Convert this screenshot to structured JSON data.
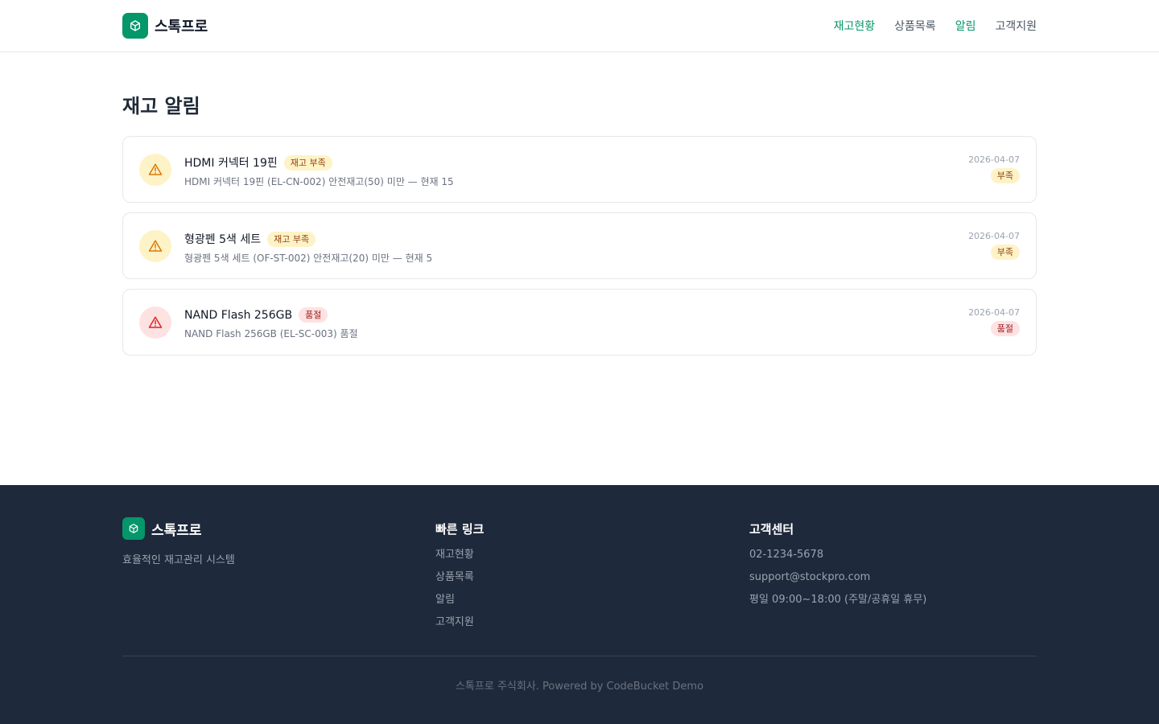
{
  "brand": {
    "name": "스톡프로",
    "logo_icon": "box-icon",
    "color": "#059669"
  },
  "nav": [
    {
      "label": "재고현황",
      "active": true
    },
    {
      "label": "상품목록",
      "active": false
    },
    {
      "label": "알림",
      "active": true
    },
    {
      "label": "고객지원",
      "active": false
    }
  ],
  "page": {
    "title": "재고 알림"
  },
  "alerts": [
    {
      "title": "HDMI 커넥터 19핀",
      "badge": "재고 부족",
      "description": "HDMI 커넥터 19핀 (EL-CN-002) 안전재고(50) 미만 — 현재 15",
      "date": "2026-04-07",
      "status": "부족",
      "level": "warn",
      "icon": "warning-triangle-icon"
    },
    {
      "title": "형광펜 5색 세트",
      "badge": "재고 부족",
      "description": "형광펜 5색 세트 (OF-ST-002) 안전재고(20) 미만 — 현재 5",
      "date": "2026-04-07",
      "status": "부족",
      "level": "warn",
      "icon": "warning-triangle-icon"
    },
    {
      "title": "NAND Flash 256GB",
      "badge": "품절",
      "description": "NAND Flash 256GB (EL-SC-003) 품절",
      "date": "2026-04-07",
      "status": "품절",
      "level": "danger",
      "icon": "warning-triangle-icon"
    }
  ],
  "footer": {
    "brand_name": "스톡프로",
    "tagline": "효율적인 재고관리 시스템",
    "quick_links": {
      "heading": "빠른 링크",
      "items": [
        "재고현황",
        "상품목록",
        "알림",
        "고객지원"
      ]
    },
    "support": {
      "heading": "고객센터",
      "phone": "02-1234-5678",
      "email": "support@stockpro.com",
      "hours": "평일 09:00~18:00 (주말/공휴일 휴무)"
    },
    "copyright": "스톡프로 주식회사. Powered by CodeBucket Demo"
  },
  "colors": {
    "accent": "#059669",
    "warn_bg": "#fef3c7",
    "warn_fg": "#d97706",
    "danger_bg": "#fee2e2",
    "danger_fg": "#dc2626",
    "footer_bg": "#1e293b"
  }
}
